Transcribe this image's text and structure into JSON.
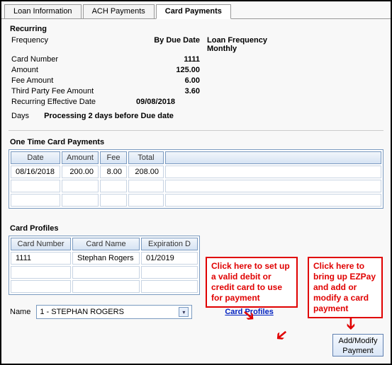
{
  "tabs": {
    "loan_info": "Loan Information",
    "ach": "ACH Payments",
    "card": "Card Payments"
  },
  "recurring": {
    "title": "Recurring",
    "frequency_label": "Frequency",
    "frequency_value": "By Due Date",
    "loan_freq_label": "Loan Frequency",
    "loan_freq_value": "Monthly",
    "card_number_label": "Card Number",
    "card_number_value": "1111",
    "amount_label": "Amount",
    "amount_value": "125.00",
    "fee_label": "Fee Amount",
    "fee_value": "6.00",
    "third_party_label": "Third Party Fee Amount",
    "third_party_value": "3.60",
    "eff_date_label": "Recurring Effective Date",
    "eff_date_value": "09/08/2018",
    "days_label": "Days",
    "days_value": "Processing 2 days before Due date"
  },
  "one_time": {
    "title": "One Time Card Payments",
    "headers": {
      "date": "Date",
      "amount": "Amount",
      "fee": "Fee",
      "total": "Total"
    },
    "row": {
      "date": "08/16/2018",
      "amount": "200.00",
      "fee": "8.00",
      "total": "208.00"
    }
  },
  "profiles": {
    "title": "Card Profiles",
    "headers": {
      "card_number": "Card Number",
      "card_name": "Card Name",
      "exp": "Expiration D"
    },
    "row": {
      "card_number": "1111",
      "card_name": "Stephan Rogers",
      "exp": "01/2019"
    }
  },
  "name_row": {
    "label": "Name",
    "value": "1 - STEPHAN  ROGERS"
  },
  "links": {
    "card_profiles": "Card Profiles"
  },
  "buttons": {
    "add_modify": "Add/Modify Payment"
  },
  "callouts": {
    "profiles": "Click here to set up a valid debit or credit card to use for payment",
    "addmod": "Click here to bring up EZPay and add or modify a card payment"
  }
}
